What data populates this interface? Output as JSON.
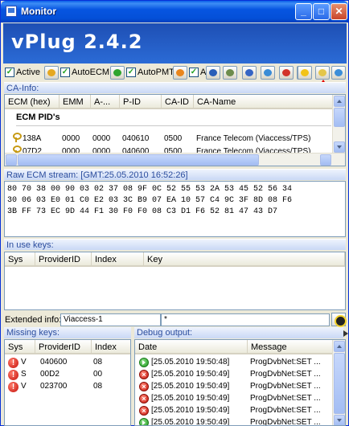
{
  "window": {
    "title": "Monitor",
    "controls": {
      "minimize": "_",
      "maximize": "□",
      "close": "✕"
    }
  },
  "banner": {
    "title": "vPlug 2.4.2"
  },
  "toolbar": {
    "active_label": "Active",
    "autoecm_label": "AutoECM",
    "autopmt_label": "AutoPMT",
    "a_label": "A",
    "checks": {
      "active": "✓",
      "autoecm": "✓",
      "autopmt": "✓",
      "a": "✓"
    },
    "icon_colors": {
      "pencil": "#e5a820",
      "green": "#2fa52f",
      "orange": "#e9861d",
      "save": "#2a5fb8",
      "ai": "#6d8c4c",
      "g": "#3565c4",
      "quote": "#3a8cd6",
      "red": "#d2342a",
      "green2": "#34a034",
      "star": "#f2c318",
      "note": "#e4c64a",
      "db": "#3c8ed8"
    }
  },
  "ca_info": {
    "label": "CA-Info:",
    "columns": [
      "ECM (hex)",
      "EMM",
      "A-...",
      "P-ID",
      "CA-ID",
      "CA-Name"
    ],
    "group_label": "ECM PID's",
    "rows": [
      {
        "ecm": "138A",
        "emm": "0000",
        "a": "0000",
        "pid": "040610",
        "caid": "0500",
        "name": "France Telecom (Viaccess/TPS)"
      },
      {
        "ecm": "07D2",
        "emm": "0000",
        "a": "0000",
        "pid": "040600",
        "caid": "0500",
        "name": "France Telecom (Viaccess/TPS)"
      }
    ]
  },
  "raw_ecm": {
    "label": "Raw ECM stream: [GMT:25.05.2010 16:52:26]",
    "lines": [
      "80 70 38 00 90 03 02 37 08 9F 0C 52 55 53 2A 53 45 52 56 34",
      "30 06 03 E0 01 C0 E2 03 3C B9 07 EA 10 57 C4 9C 3F 8D 08 F6",
      "3B FF 73 EC 9D 44 F1 30 F0 F0 08 C3 D1 F6 52 81 47 43 D7"
    ]
  },
  "in_use_keys": {
    "label": "In use keys:",
    "columns": [
      "Sys",
      "ProviderID",
      "Index",
      "Key"
    ]
  },
  "extended_info": {
    "label": "Extended info:",
    "value": "Viaccess-1",
    "value2": "*"
  },
  "missing_keys": {
    "label": "Missing keys:",
    "columns": [
      "Sys",
      "ProviderID",
      "Index"
    ],
    "rows": [
      {
        "sys": "V",
        "provider": "040600",
        "index": "08"
      },
      {
        "sys": "S",
        "provider": "00D2",
        "index": "00"
      },
      {
        "sys": "V",
        "provider": "023700",
        "index": "08"
      }
    ]
  },
  "debug_output": {
    "label": "Debug output:",
    "columns": [
      "Date",
      "Message"
    ],
    "rows": [
      {
        "status": "ok",
        "date": "[25.05.2010 19:50:48]",
        "message": "ProgDvbNet:SET ..."
      },
      {
        "status": "error",
        "date": "[25.05.2010 19:50:49]",
        "message": "ProgDvbNet:SET ..."
      },
      {
        "status": "error",
        "date": "[25.05.2010 19:50:49]",
        "message": "ProgDvbNet:SET ..."
      },
      {
        "status": "error",
        "date": "[25.05.2010 19:50:49]",
        "message": "ProgDvbNet:SET ..."
      },
      {
        "status": "error",
        "date": "[25.05.2010 19:50:49]",
        "message": "ProgDvbNet:SET ..."
      },
      {
        "status": "ok",
        "date": "[25.05.2010 19:50:49]",
        "message": "ProgDvbNet:SET ..."
      }
    ]
  }
}
